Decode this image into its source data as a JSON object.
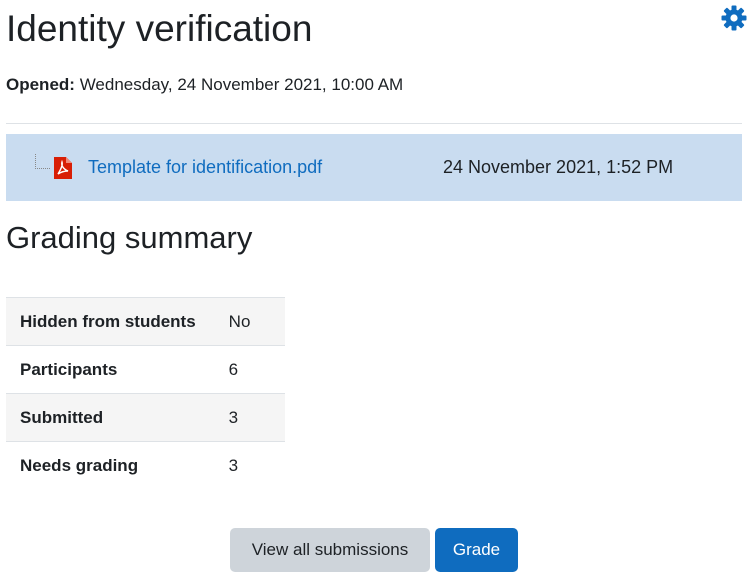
{
  "page": {
    "title": "Identity verification"
  },
  "icons": {
    "settings": "gear-icon",
    "file": "pdf-icon",
    "gear_color": "#0f6cbf",
    "pdf_color": "#d81e05"
  },
  "dates": {
    "opened_label": "Opened:",
    "opened_value": "Wednesday, 24 November 2021, 10:00 AM"
  },
  "attachment": {
    "filename": "Template for identification.pdf",
    "date": "24 November 2021, 1:52 PM"
  },
  "grading_summary": {
    "title": "Grading summary",
    "rows": [
      {
        "label": "Hidden from students",
        "value": "No"
      },
      {
        "label": "Participants",
        "value": "6"
      },
      {
        "label": "Submitted",
        "value": "3"
      },
      {
        "label": "Needs grading",
        "value": "3"
      }
    ]
  },
  "actions": {
    "view_all_label": "View all submissions",
    "grade_label": "Grade"
  },
  "colors": {
    "primary": "#0f6cbf",
    "file_row_bg": "#c9dcf0",
    "secondary_button": "#ced4da"
  }
}
